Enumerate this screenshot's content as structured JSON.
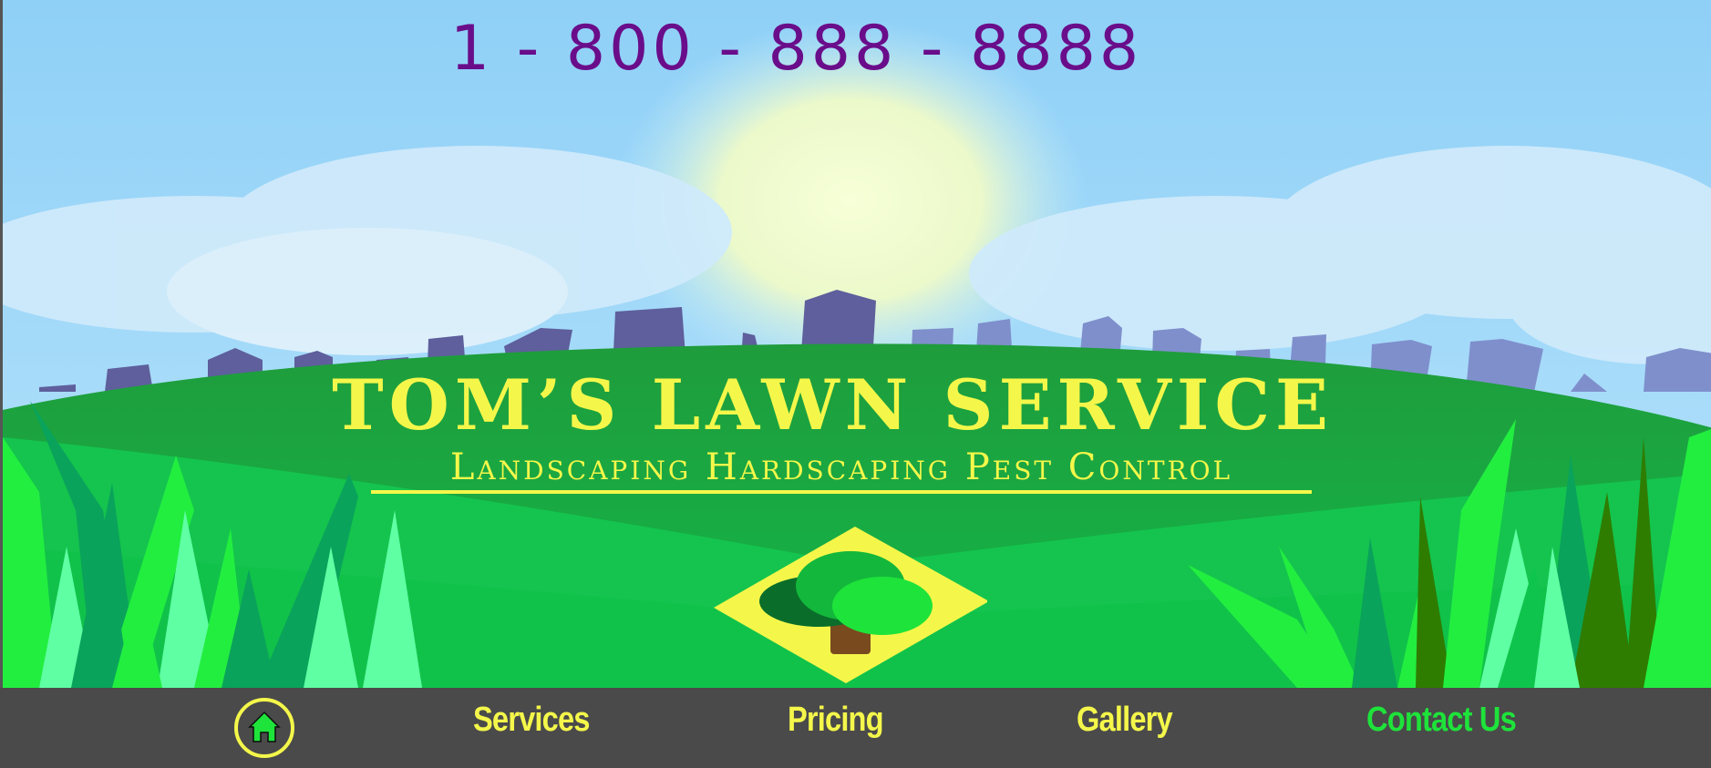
{
  "header": {
    "phone": "1 - 800 - 888 - 8888",
    "title": "TOM’S LAWN SERVICE",
    "subtitle": "Landscaping Hardscaping Pest Control"
  },
  "logo": {
    "icon": "tree-icon"
  },
  "nav": {
    "home_icon": "home-icon",
    "items": [
      {
        "label": "Services"
      },
      {
        "label": "Pricing"
      },
      {
        "label": "Gallery"
      },
      {
        "label": "Contact Us"
      }
    ]
  },
  "colors": {
    "accent_yellow": "#f4f74a",
    "phone_purple": "#6a0d8a",
    "active_green": "#1ee33a",
    "nav_bg": "#4a4a4a"
  }
}
